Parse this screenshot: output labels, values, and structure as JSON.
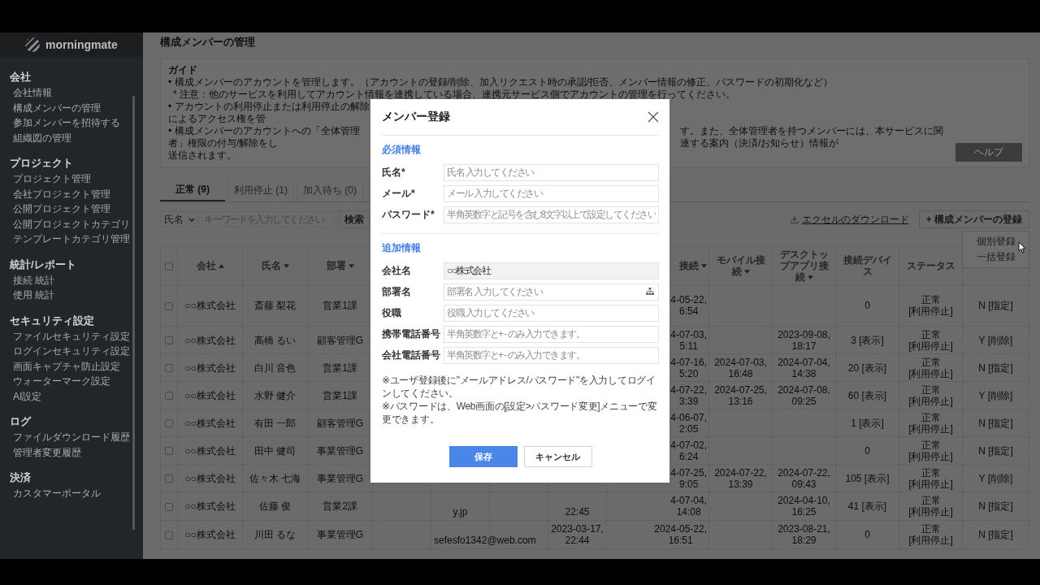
{
  "sidebar": {
    "logo": "morningmate",
    "sections": [
      {
        "title": "会社",
        "items": [
          "会社情報",
          "構成メンバーの管理",
          "参加メンバーを招待する",
          "組織図の管理"
        ]
      },
      {
        "title": "プロジェクト",
        "items": [
          "プロジェクト管理",
          "会社プロジェクト管理",
          "公開プロジェクト管理",
          "公開プロジェクトカテゴリ",
          "テンプレートカテゴリ管理"
        ]
      },
      {
        "title": "統計/レポート",
        "items": [
          "接続 統計",
          "使用 統計"
        ]
      },
      {
        "title": "セキュリティ設定",
        "items": [
          "ファイルセキュリティ設定",
          "ログインセキュリティ設定",
          "画面キャプチャ防止設定",
          "ウォーターマーク設定",
          "AI設定"
        ]
      },
      {
        "title": "ログ",
        "items": [
          "ファイルダウンロード履歴",
          "管理者変更履歴"
        ]
      },
      {
        "title": "決済",
        "items": [
          "カスタマーポータル"
        ]
      }
    ]
  },
  "page": {
    "title": "構成メンバーの管理"
  },
  "guide": {
    "title": "ガイド",
    "lines": [
      {
        "kind": "bullet",
        "left": "• 構成メンバーのアカウントを管理します。（アカウントの登録/削除、加入リクエスト時の承認/拒否、メンバー情報の修正、パスワードの初期化など）"
      },
      {
        "kind": "note",
        "left": "* 注意：他のサービスを利用してアカウント情報を連携している場合、連携元サービス側でアカウントの管理を行ってください。"
      },
      {
        "kind": "bullet",
        "left": "• アカウントの利用停止または利用停止の解除によるアクセス権を管"
      },
      {
        "kind": "bullet",
        "left": "• 構成メンバーのアカウントへの「全体管理者」権限の付与/解除をし",
        "right": "す。また、全体管理者を持つメンバーには、本サービスに関連する案内（決済/お知らせ）情報が"
      },
      {
        "kind": "plain",
        "left": "送信されます。"
      }
    ]
  },
  "help_button": "ヘルプ",
  "tabs": [
    {
      "label": "正常 (9)",
      "selected": true
    },
    {
      "label": "利用停止 (1)",
      "selected": false
    },
    {
      "label": "加入待ち (0)",
      "selected": false
    }
  ],
  "search": {
    "field": "氏名",
    "placeholder": "キーワードを入力してください",
    "button": "検索"
  },
  "download_link": "エクセルのダウンロード",
  "register_button": "+ 構成メンバーの登録",
  "register_menu": [
    "個別登録",
    "一括登録"
  ],
  "table": {
    "select_all_checked": false,
    "columns": [
      {
        "label": "会社",
        "ascending": true
      },
      {
        "label": "氏名",
        "ascending": false
      },
      {
        "label": "部署",
        "ascending": false
      },
      {},
      {},
      {},
      {},
      {
        "label": "接続",
        "ascending": false
      },
      {
        "label": "モバイル接続",
        "ascending": false
      },
      {
        "label": "デスクトップアプリ接続",
        "ascending": false
      },
      {
        "label": "接続デバイス"
      },
      {
        "label": "ステータス"
      },
      {}
    ],
    "rows": [
      {
        "checked": false,
        "cells": [
          "○○株式会社",
          "斎藤 梨花",
          "営業1課",
          null,
          null,
          null,
          null,
          "4-05-22,\n6:54",
          null,
          null,
          "0",
          "正常\n[利用停止]",
          "N [指定]"
        ]
      },
      {
        "checked": false,
        "cells": [
          "○○株式会社",
          "高橋 るい",
          "顧客管理G",
          null,
          null,
          null,
          null,
          "4-07-03,\n5:11",
          null,
          "2023-09-08,\n18:17",
          "3 [表示]",
          "正常\n[利用停止]",
          "Y [削除]"
        ]
      },
      {
        "checked": false,
        "cells": [
          "○○株式会社",
          "白川 音色",
          "営業1課",
          null,
          null,
          null,
          null,
          "4-07-16,\n5:20",
          "2024-07-03,\n16:48",
          "2024-07-04,\n14:38",
          "20 [表示]",
          "正常\n[利用停止]",
          "N [指定]"
        ]
      },
      {
        "checked": false,
        "cells": [
          "○○株式会社",
          "水野 健介",
          "営業1課",
          null,
          null,
          null,
          null,
          "4-07-22,\n3:39",
          "2024-07-25,\n13:16",
          "2024-07-08,\n09:25",
          "60 [表示]",
          "正常\n[利用停止]",
          "Y [削除]"
        ]
      },
      {
        "checked": false,
        "cells": [
          "○○株式会社",
          "有田 一郎",
          "顧客管理G",
          null,
          null,
          null,
          null,
          "4-06-07,\n2:05",
          null,
          null,
          "1 [表示]",
          "正常\n[利用停止]",
          "N [指定]"
        ]
      },
      {
        "checked": false,
        "cells": [
          "○○株式会社",
          "田中 健司",
          "事業管理G",
          null,
          null,
          null,
          null,
          "4-07-02,\n6:24",
          null,
          null,
          "0",
          "正常\n[利用停止]",
          "N [指定]"
        ]
      },
      {
        "checked": false,
        "cells": [
          "○○株式会社",
          "佐々木 七海",
          "事業管理G",
          null,
          null,
          null,
          null,
          "4-07-25,\n9:05",
          "2024-07-22,\n13:39",
          "2024-07-22,\n09:43",
          "105 [表示]",
          "正常\n[利用停止]",
          "Y [削除]"
        ]
      },
      {
        "checked": false,
        "cells": [
          "○○株式会社",
          "佐藤 俊",
          "営業2課",
          null,
          "y.jp",
          null,
          "22:45",
          "4-07-04,\n14:08",
          null,
          "2024-04-10,\n16:25",
          "41 [表示]",
          "正常\n[利用停止]",
          "N [指定]"
        ]
      },
      {
        "checked": false,
        "cells": [
          "○○株式会社",
          "川田 るな",
          "事業管理G",
          null,
          "sefesfo1342@web.com",
          null,
          "2023-03-17,\n22:44",
          "2024-05-22,\n16:51",
          null,
          "2023-08-21,\n18:29",
          "0",
          "正常\n[利用停止]",
          "N [指定]"
        ]
      }
    ]
  },
  "modal": {
    "title": "メンバー登録",
    "sections": [
      {
        "title": "必須情報",
        "fields": [
          {
            "kind": "text",
            "label": "氏名*",
            "placeholder": "氏名 入力してください"
          },
          {
            "kind": "text",
            "label": "メール*",
            "placeholder": "メール 入力してください"
          },
          {
            "kind": "text",
            "label": "パスワード*",
            "placeholder": "半角英数字と記号を含む8文字以上で設定してください"
          }
        ]
      },
      {
        "title": "追加情報",
        "fields": [
          {
            "kind": "readonly",
            "label": "会社名",
            "value": "○○株式会社"
          },
          {
            "kind": "picker",
            "label": "部署名",
            "placeholder": "部署名 入力してください"
          },
          {
            "kind": "text",
            "label": "役職",
            "placeholder": "役職 入力してください"
          },
          {
            "kind": "text",
            "label": "携帯電話番号",
            "placeholder": "半角英数字と+ - のみ入力できます。"
          },
          {
            "kind": "text",
            "label": "会社電話番号",
            "placeholder": "半角英数字と+ - のみ入力できます。"
          }
        ]
      }
    ],
    "notes": [
      "※ユーザ登録後に\"メールアドレス/パスワード\"を入力してログインしてください。",
      "※パスワードは、Web画面の[設定>パスワード変更]メニューで変更できます。"
    ],
    "buttons": [
      {
        "kind": "primary",
        "label": "保存"
      },
      {
        "kind": "secondary",
        "label": "キャンセル"
      }
    ]
  }
}
